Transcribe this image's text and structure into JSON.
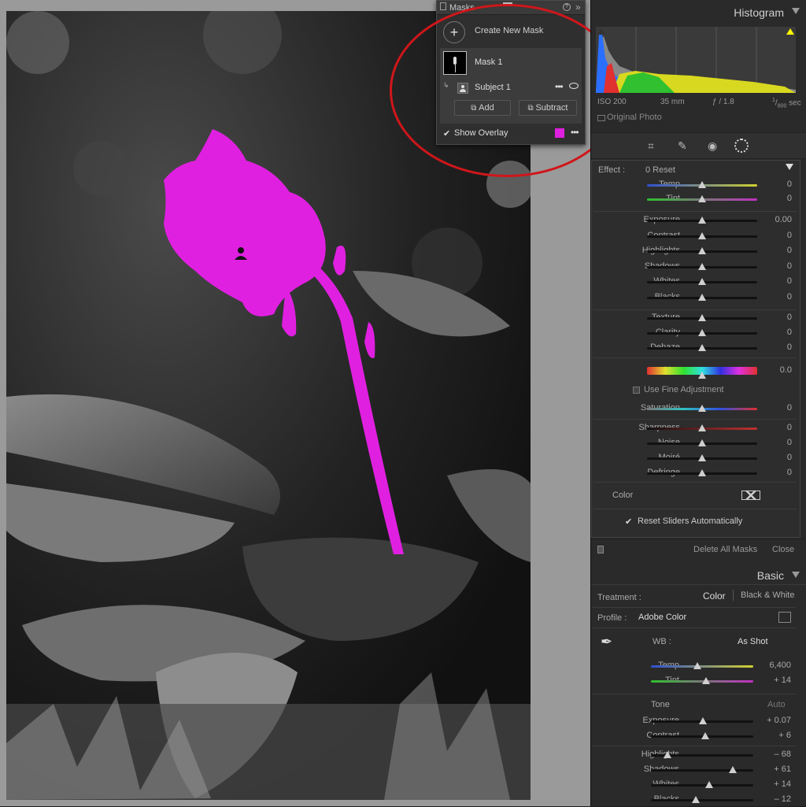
{
  "masks_panel": {
    "title": "Masks",
    "create_label": "Create New Mask",
    "mask_name": "Mask 1",
    "subject_name": "Subject 1",
    "add_label": "Add",
    "subtract_label": "Subtract",
    "show_overlay_label": "Show Overlay",
    "overlay_color": "#e020e0"
  },
  "histogram": {
    "title": "Histogram",
    "iso": "ISO 200",
    "focal": "35 mm",
    "aperture": "ƒ / 1.8",
    "shutter_num": "1",
    "shutter_den": "800",
    "shutter_unit": "sec",
    "original_photo_label": "Original Photo"
  },
  "mask_adjust": {
    "effect_label": "Effect :",
    "effect_value": "0 Reset",
    "sliders1": [
      {
        "label": "Temp",
        "value": "0",
        "pos": 0.5
      },
      {
        "label": "Tint",
        "value": "0",
        "pos": 0.5
      }
    ],
    "sliders2": [
      {
        "label": "Exposure",
        "value": "0.00",
        "pos": 0.5
      },
      {
        "label": "Contrast",
        "value": "0",
        "pos": 0.5
      },
      {
        "label": "Highlights",
        "value": "0",
        "pos": 0.5
      },
      {
        "label": "Shadows",
        "value": "0",
        "pos": 0.5
      },
      {
        "label": "Whites",
        "value": "0",
        "pos": 0.5
      },
      {
        "label": "Blacks",
        "value": "0",
        "pos": 0.5
      }
    ],
    "sliders3": [
      {
        "label": "Texture",
        "value": "0",
        "pos": 0.5
      },
      {
        "label": "Clarity",
        "value": "0",
        "pos": 0.5
      },
      {
        "label": "Dehaze",
        "value": "0",
        "pos": 0.5
      }
    ],
    "hue_label": "Hue",
    "hue_value": "0.0",
    "fine_adjust_label": "Use Fine Adjustment",
    "saturation_label": "Saturation",
    "saturation_value": "0",
    "sliders4": [
      {
        "label": "Sharpness",
        "value": "0",
        "pos": 0.5
      },
      {
        "label": "Noise",
        "value": "0",
        "pos": 0.5
      },
      {
        "label": "Moiré",
        "value": "0",
        "pos": 0.5
      },
      {
        "label": "Defringe",
        "value": "0",
        "pos": 0.5
      }
    ],
    "color_label": "Color",
    "reset_sliders_label": "Reset Sliders Automatically",
    "delete_all_label": "Delete All Masks",
    "close_label": "Close"
  },
  "basic": {
    "title": "Basic",
    "treatment_label": "Treatment :",
    "color_label": "Color",
    "bw_label": "Black & White",
    "profile_label": "Profile :",
    "profile_value": "Adobe Color",
    "wb_label": "WB :",
    "wb_value": "As Shot",
    "wb_sliders": [
      {
        "label": "Temp",
        "value": "6,400",
        "pos": 0.45
      },
      {
        "label": "Tint",
        "value": "+ 14",
        "pos": 0.54
      }
    ],
    "tone_label": "Tone",
    "auto_label": "Auto",
    "tone_sliders": [
      {
        "label": "Exposure",
        "value": "+ 0.07",
        "pos": 0.51
      },
      {
        "label": "Contrast",
        "value": "+ 6",
        "pos": 0.53
      }
    ],
    "tone_sliders2": [
      {
        "label": "Highlights",
        "value": "– 68",
        "pos": 0.16
      },
      {
        "label": "Shadows",
        "value": "+ 61",
        "pos": 0.8
      },
      {
        "label": "Whites",
        "value": "+ 14",
        "pos": 0.57
      },
      {
        "label": "Blacks",
        "value": "– 12",
        "pos": 0.44
      }
    ]
  }
}
